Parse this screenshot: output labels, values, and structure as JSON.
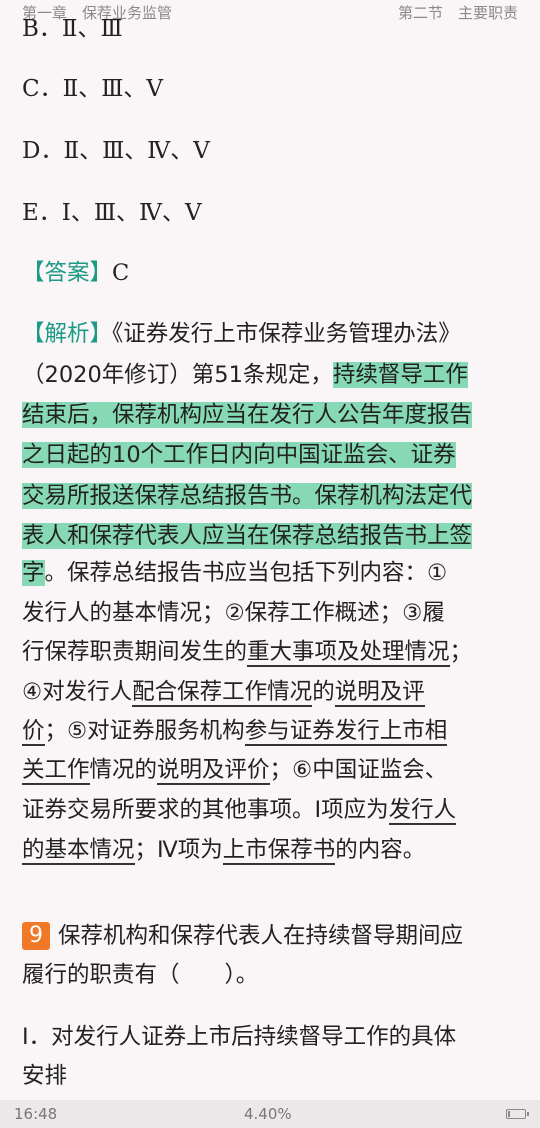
{
  "header": {
    "chapter": "第一章　保荐业务监管",
    "section": "第二节　主要职责"
  },
  "options": [
    "B．Ⅱ、Ⅲ",
    "C．Ⅱ、Ⅲ、Ⅴ",
    "D．Ⅱ、Ⅲ、Ⅳ、Ⅴ",
    "E．Ⅰ、Ⅲ、Ⅳ、Ⅴ"
  ],
  "answer": {
    "label": "【答案】",
    "value": "C"
  },
  "analysis": {
    "label": "【解析】",
    "l1": "《证券发行上市保荐业务管理办法》",
    "l2a": "（2020年修订）第51条规定，",
    "l2b": "持续督导工作",
    "l3": "结束后，保荐机构应当在发行人公告年度报告",
    "l4": "之日起的10个工作日内向中国证监会、证券",
    "l5": "交易所报送保荐总结报告书。保荐机构法定代",
    "l6": "表人和保荐代表人应当在保荐总结报告书上签",
    "l7a": "字",
    "l7b": "。保荐总结报告书应当包括下列内容：①",
    "l8": "发行人的基本情况；②保荐工作概述；③履",
    "l9a": "行保荐职责期间发生的",
    "l9b": "重大事项及处理情况",
    "l9c": "；",
    "l10a": "④对发行人",
    "l10b": "配合保荐工作情况",
    "l10c": "的",
    "l10d": "说明及评",
    "l11a": "价",
    "l11b": "；⑤对证券服务机构",
    "l11c": "参与证券发行上市相",
    "l12a": "关工作",
    "l12b": "情况的",
    "l12c": "说明及评价",
    "l12d": "；⑥中国证监会、",
    "l13a": "证券交易所要求的其他事项。Ⅰ项应为",
    "l13b": "发行人",
    "l14a": "的基本情况",
    "l14b": "；Ⅳ项为",
    "l14c": "上市保荐书",
    "l14d": "的内容。"
  },
  "question": {
    "number": "9",
    "line1": "保荐机构和保荐代表人在持续督导期间应",
    "line2": "履行的职责有（　　）。"
  },
  "item1": {
    "line1": "Ⅰ．对发行人证券上市后持续督导工作的具体",
    "line2": "安排"
  },
  "statusbar": {
    "time": "16:48",
    "progress": "4.40%",
    "battery_level": 0.15
  }
}
